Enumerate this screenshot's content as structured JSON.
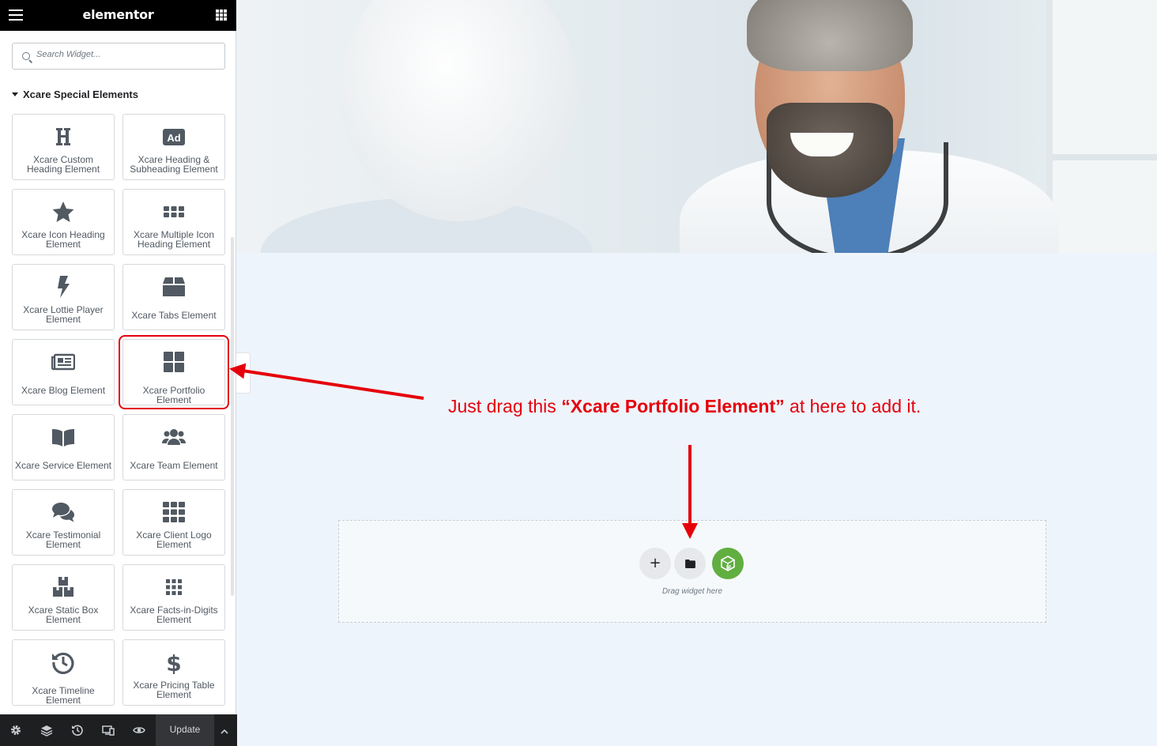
{
  "app": {
    "logo_text": "elementor"
  },
  "search": {
    "placeholder": "Search Widget..."
  },
  "category": {
    "title": "Xcare Special Elements"
  },
  "widgets": [
    {
      "label": "Xcare Custom Heading Element",
      "icon": "heading-icon"
    },
    {
      "label": "Xcare Heading & Subheading Element",
      "icon": "ad-icon"
    },
    {
      "label": "Xcare Icon Heading Element",
      "icon": "star-icon"
    },
    {
      "label": "Xcare Multiple Icon Heading Element",
      "icon": "grid-dots-icon"
    },
    {
      "label": "Xcare Lottie Player Element",
      "icon": "bolt-icon"
    },
    {
      "label": "Xcare Tabs Element",
      "icon": "box-icon"
    },
    {
      "label": "Xcare Blog Element",
      "icon": "newspaper-icon"
    },
    {
      "label": "Xcare Portfolio Element",
      "icon": "th-large-icon"
    },
    {
      "label": "Xcare Service Element",
      "icon": "book-open-icon"
    },
    {
      "label": "Xcare Team Element",
      "icon": "users-icon"
    },
    {
      "label": "Xcare Testimonial Element",
      "icon": "comments-icon"
    },
    {
      "label": "Xcare Client Logo Element",
      "icon": "th-icon"
    },
    {
      "label": "Xcare Static Box Element",
      "icon": "boxes-icon"
    },
    {
      "label": "Xcare Facts-in-Digits Element",
      "icon": "dots-grid-icon"
    },
    {
      "label": "Xcare Timeline Element",
      "icon": "history-icon"
    },
    {
      "label": "Xcare Pricing Table Element",
      "icon": "dollar-icon"
    }
  ],
  "footer": {
    "update_label": "Update",
    "icons": [
      "settings-icon",
      "layers-icon",
      "history-icon",
      "responsive-icon",
      "eye-icon",
      "chevron-up-icon"
    ]
  },
  "canvas": {
    "drop_label": "Drag widget here",
    "buttons": [
      "plus-icon",
      "folder-icon",
      "em-icon"
    ]
  },
  "annotation": {
    "prefix": "Just drag this ",
    "highlight": "“Xcare Portfolio Element”",
    "suffix": " at here to add it."
  },
  "colors": {
    "accent_red": "#e5000b",
    "topbar": "#000000",
    "em_green": "#61ae41",
    "canvas_bg": "#eef4fb"
  }
}
